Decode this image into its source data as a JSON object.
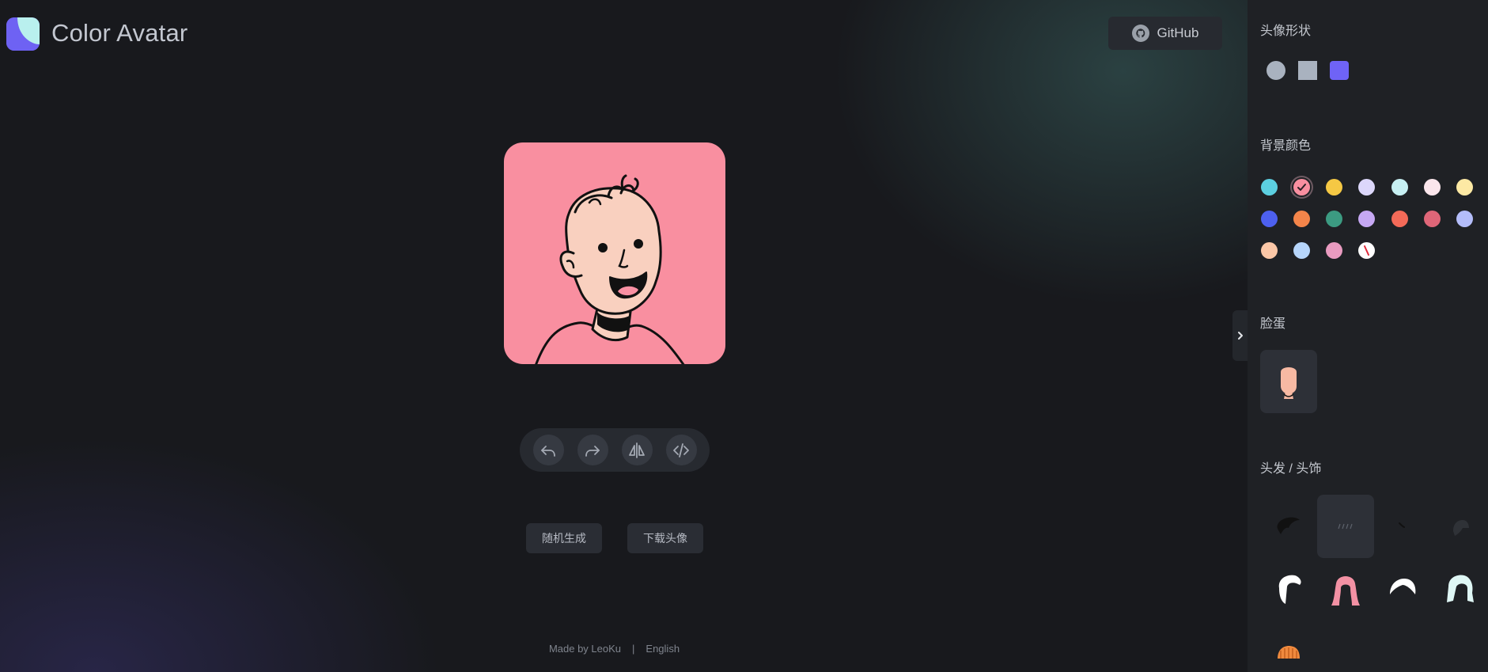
{
  "app": {
    "title": "Color Avatar"
  },
  "header": {
    "github_label": "GitHub"
  },
  "actions": {
    "undo": "undo-icon",
    "redo": "redo-icon",
    "flip": "flip-icon",
    "code": "code-icon"
  },
  "buttons": {
    "random": "随机生成",
    "download": "下载头像"
  },
  "footer": {
    "made_by": "Made by LeoKu",
    "separator": "|",
    "language": "English"
  },
  "sidebar": {
    "shape_title": "头像形状",
    "shapes": [
      "circle",
      "square",
      "squircle"
    ],
    "background_title": "背景颜色",
    "background_colors": [
      "#5ccfe0",
      "#f98fa0",
      "#f5c844",
      "#dcd7fb",
      "#c7f0f3",
      "#fbe6ec",
      "#fde9a4",
      "#4d60ef",
      "#f4854a",
      "#3c9b82",
      "#c6a8f4",
      "#f46a58",
      "#df6678",
      "#b4bdfa",
      "#fbc7a7",
      "#b6d5fb",
      "#e99bc0",
      "none"
    ],
    "selected_background": "#f98fa0",
    "face_title": "脸蛋",
    "hair_title": "头发 / 头饰"
  }
}
